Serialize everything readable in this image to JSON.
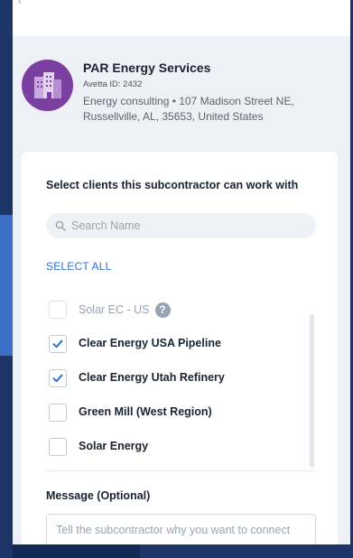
{
  "company": {
    "name": "PAR Energy Services",
    "avetta_id": "Avetta ID: 2432",
    "description": "Energy consulting • 107 Madison Street NE, Russellville, AL, 35653, United States"
  },
  "clients_section": {
    "heading": "Select clients this subcontractor can work with",
    "search_placeholder": "Search Name",
    "select_all_label": "SELECT ALL",
    "items": [
      {
        "label": "Solar EC - US",
        "checked": false,
        "disabled": true,
        "has_help": true
      },
      {
        "label": "Clear Energy USA Pipeline",
        "checked": true
      },
      {
        "label": "Clear Energy Utah Refinery",
        "checked": true
      },
      {
        "label": "Green Mill (West Region)",
        "checked": false
      },
      {
        "label": "Solar Energy",
        "checked": false
      }
    ]
  },
  "message": {
    "label": "Message (Optional)",
    "placeholder": "Tell the subcontractor why you want to connect"
  },
  "colors": {
    "accent": "#2f6fcf",
    "avatar": "#7b3fa1",
    "backdrop": "#1c3566"
  }
}
